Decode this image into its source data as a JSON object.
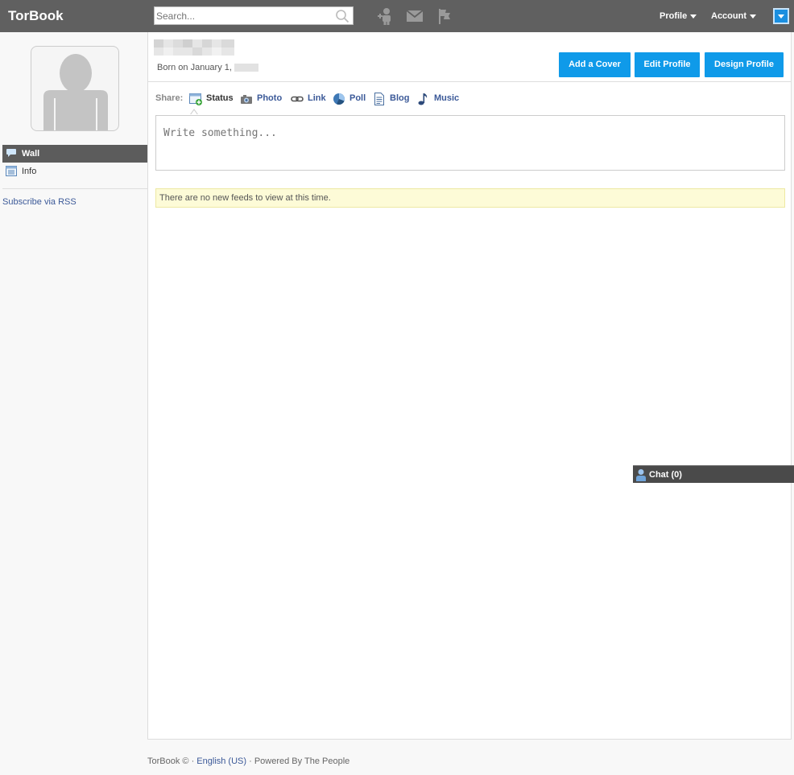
{
  "app": {
    "title": "TorBook"
  },
  "search": {
    "placeholder": "Search..."
  },
  "topbar": {
    "icons": [
      "friend-requests-icon",
      "messages-icon",
      "notifications-icon"
    ],
    "menus": [
      {
        "label": "Profile"
      },
      {
        "label": "Account"
      }
    ]
  },
  "sidebar": {
    "items": [
      {
        "label": "Wall",
        "icon": "speech-bubble-icon",
        "active": true
      },
      {
        "label": "Info",
        "icon": "info-list-icon",
        "active": false
      }
    ],
    "rss_label": "Subscribe via RSS"
  },
  "profile": {
    "born_label": "Born on January 1,"
  },
  "header_buttons": {
    "add_cover": "Add a Cover",
    "edit_profile": "Edit Profile",
    "design_profile": "Design Profile"
  },
  "share": {
    "label": "Share:",
    "items": [
      {
        "label": "Status",
        "icon": "status-icon",
        "active": true
      },
      {
        "label": "Photo",
        "icon": "camera-icon",
        "active": false
      },
      {
        "label": "Link",
        "icon": "link-icon",
        "active": false
      },
      {
        "label": "Poll",
        "icon": "poll-icon",
        "active": false
      },
      {
        "label": "Blog",
        "icon": "blog-icon",
        "active": false
      },
      {
        "label": "Music",
        "icon": "music-icon",
        "active": false
      }
    ]
  },
  "composer": {
    "placeholder": "Write something..."
  },
  "feed": {
    "empty_notice": "There are no new feeds to view at this time."
  },
  "chat": {
    "label": "Chat (0)"
  },
  "footer": {
    "brand": "TorBook © · ",
    "language": "English (US)",
    "powered": " · Powered By The People"
  },
  "colors": {
    "topbar": "#606060",
    "accent_button": "#0f9ae9",
    "link": "#3b5998",
    "notice_bg": "#fdfbd7"
  }
}
